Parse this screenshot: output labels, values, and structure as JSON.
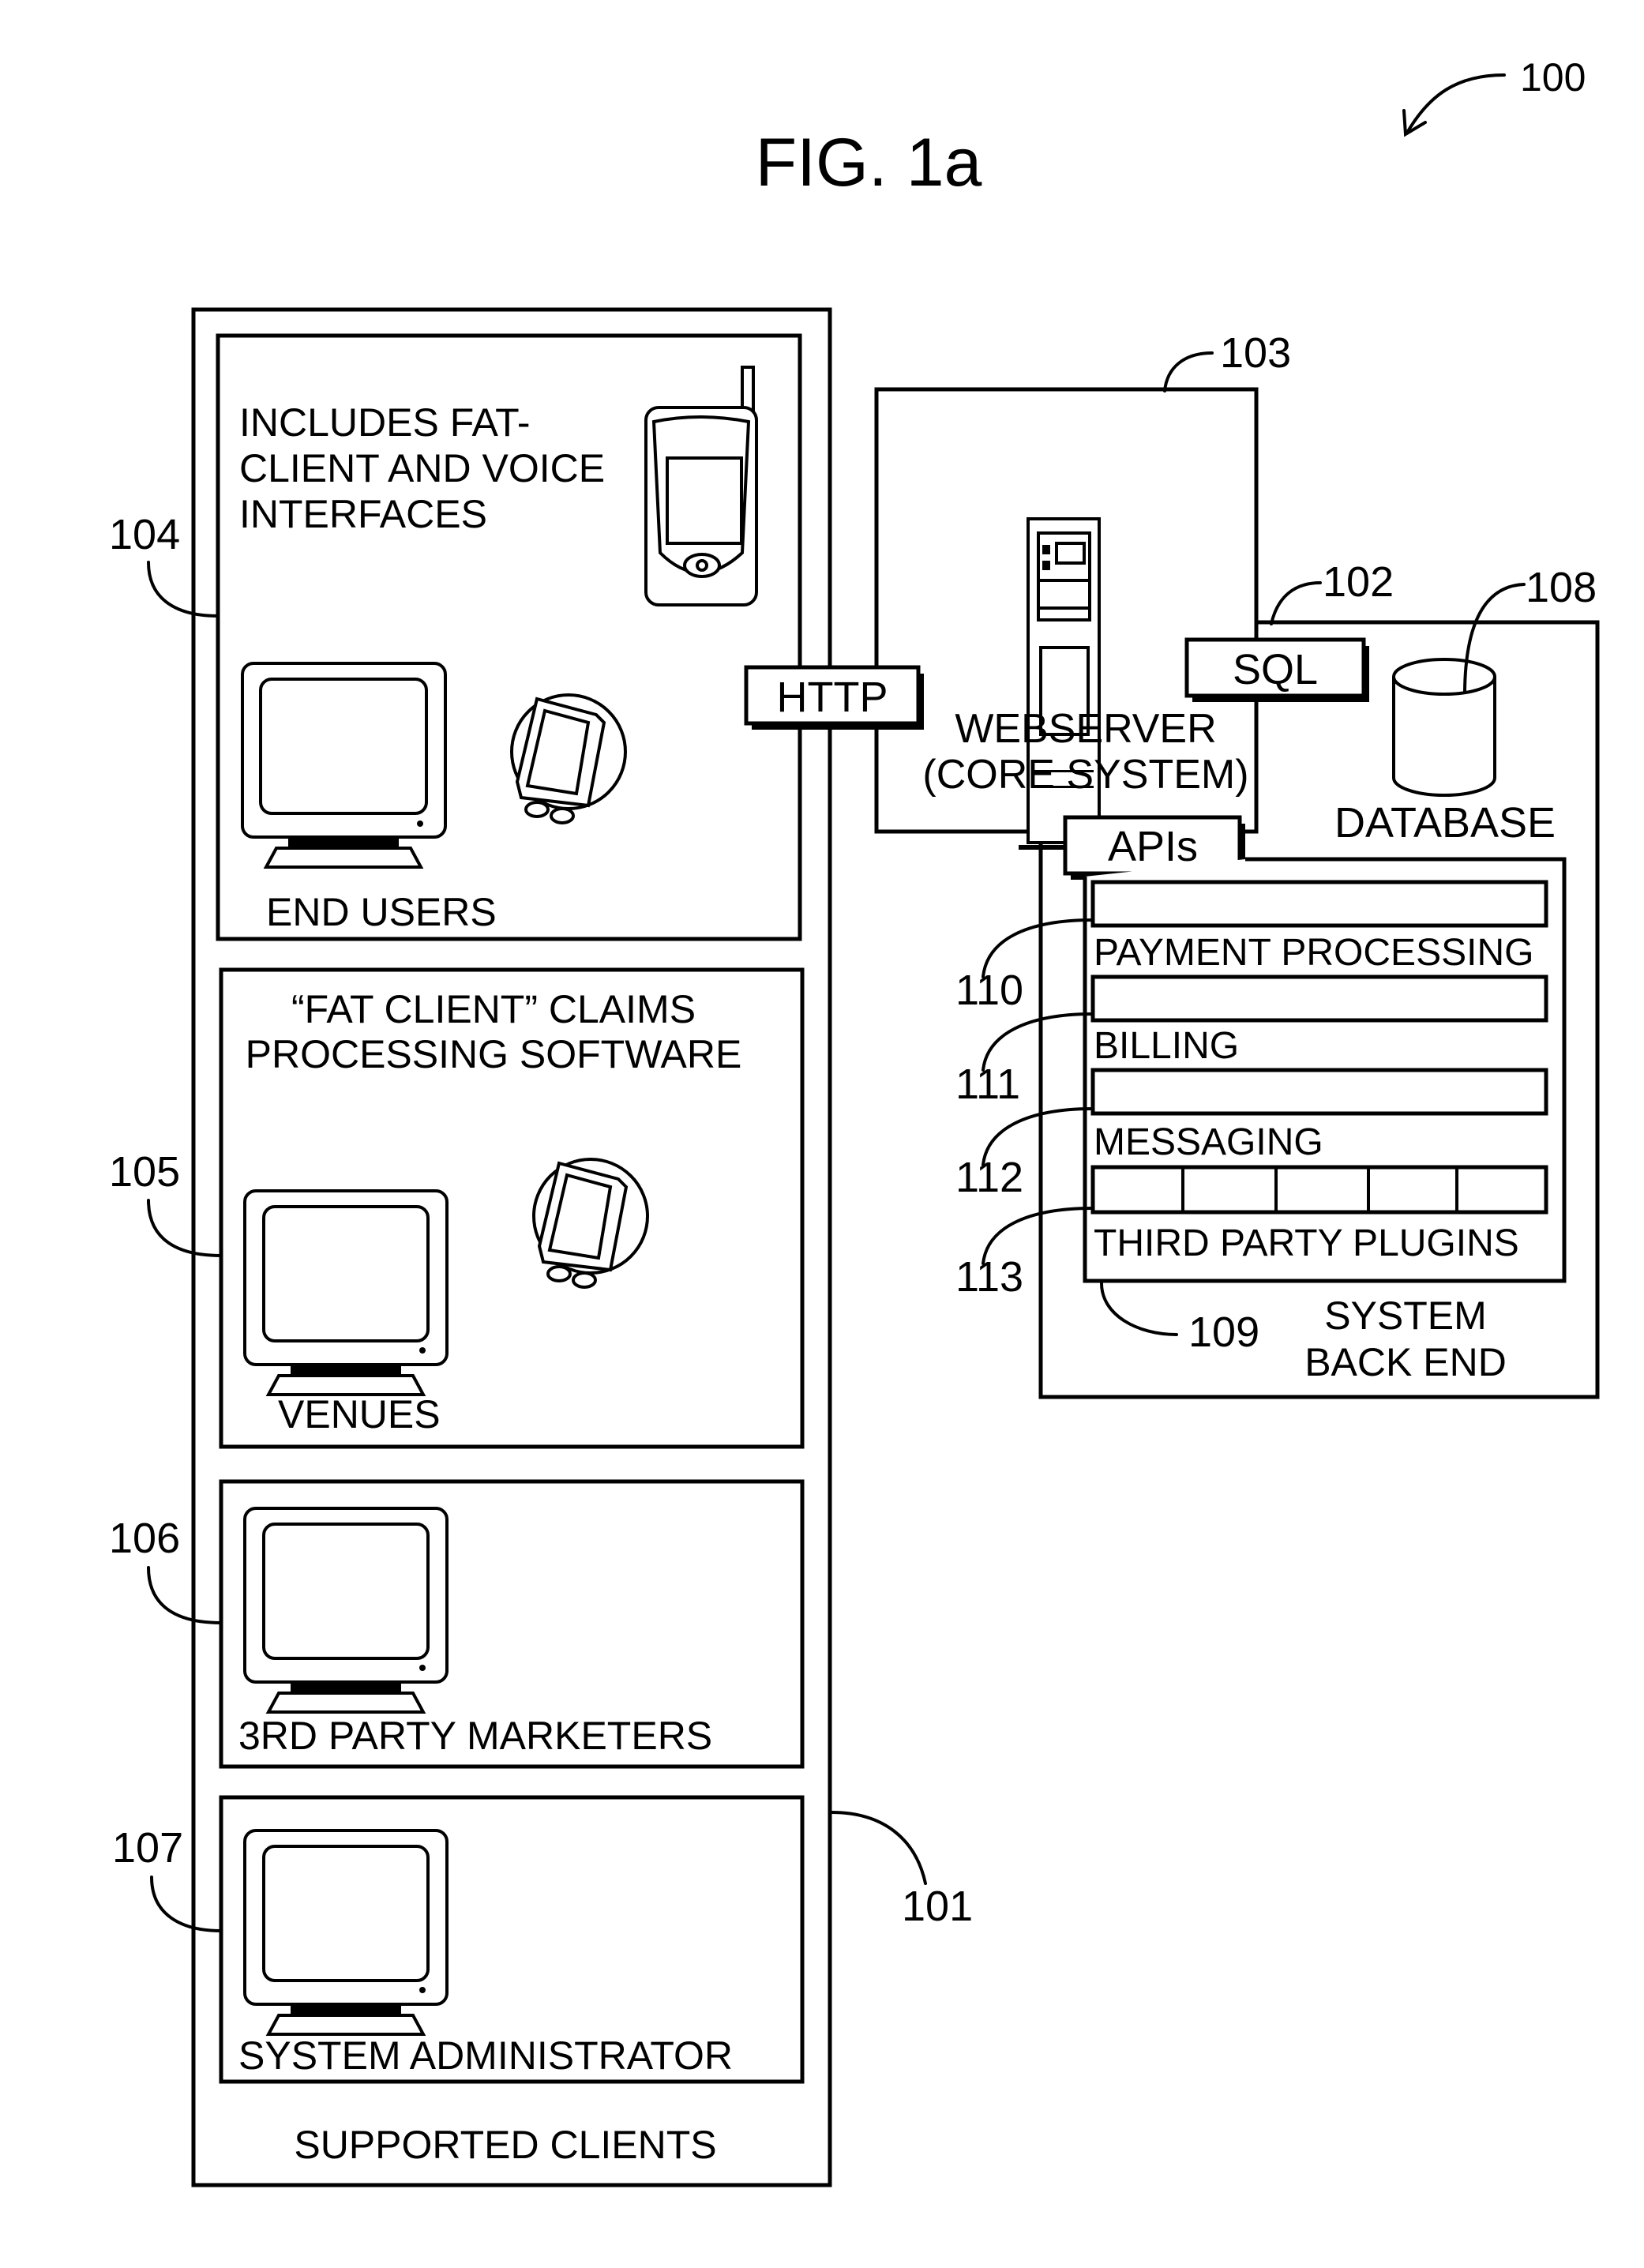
{
  "figure": {
    "title": "FIG. 1a",
    "ref_overall": "100"
  },
  "clients": {
    "ref": "101",
    "caption": "SUPPORTED CLIENTS",
    "panels": [
      {
        "ref": "104",
        "description_lines": [
          "INCLUDES FAT-",
          "CLIENT AND VOICE",
          "INTERFACES"
        ],
        "label": "END USERS",
        "icons": [
          "mobile-phone-icon",
          "monitor-icon",
          "pda-icon"
        ]
      },
      {
        "ref": "105",
        "description_lines": [
          "“FAT CLIENT” CLAIMS",
          "PROCESSING SOFTWARE"
        ],
        "label": "VENUES",
        "icons": [
          "monitor-icon",
          "pda-icon"
        ]
      },
      {
        "ref": "106",
        "label": "3RD PARTY MARKETERS",
        "icons": [
          "monitor-icon"
        ]
      },
      {
        "ref": "107",
        "label": "SYSTEM ADMINISTRATOR",
        "icons": [
          "monitor-icon"
        ]
      }
    ]
  },
  "connectors": {
    "http": "HTTP",
    "sql": "SQL",
    "apis": "APIs"
  },
  "webserver": {
    "ref": "103",
    "label_lines": [
      "WEBSERVER",
      "(CORE SYSTEM)"
    ]
  },
  "backend": {
    "ref": "102",
    "caption_lines": [
      "SYSTEM",
      "BACK END"
    ],
    "database": {
      "ref": "108",
      "label": "DATABASE"
    },
    "modules_group_ref": "109",
    "modules": [
      {
        "ref": "110",
        "label": "PAYMENT PROCESSING"
      },
      {
        "ref": "111",
        "label": "BILLING"
      },
      {
        "ref": "112",
        "label": "MESSAGING"
      },
      {
        "ref": "113",
        "label": "THIRD PARTY PLUGINS",
        "slots": 5
      }
    ]
  }
}
